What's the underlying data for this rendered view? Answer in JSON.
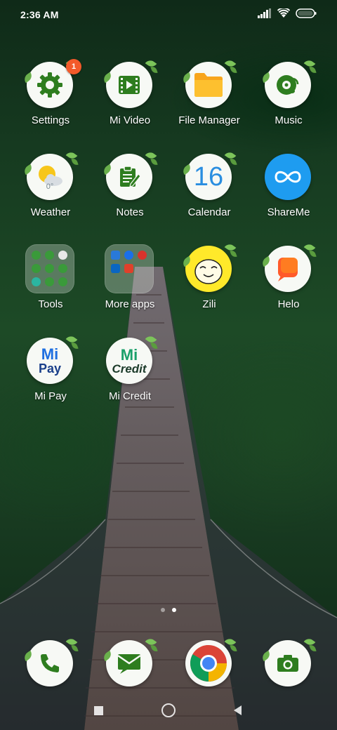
{
  "status_bar": {
    "time": "2:36 AM",
    "icons": [
      "signal-icon",
      "wifi-icon",
      "battery-icon"
    ]
  },
  "apps": [
    {
      "label": "Settings",
      "icon": "gear-icon",
      "badge": "1"
    },
    {
      "label": "Mi Video",
      "icon": "film-icon"
    },
    {
      "label": "File Manager",
      "icon": "folder-icon"
    },
    {
      "label": "Music",
      "icon": "music-disc-icon"
    },
    {
      "label": "Weather",
      "icon": "sun-cloud-icon",
      "temp": "0°"
    },
    {
      "label": "Notes",
      "icon": "note-icon"
    },
    {
      "label": "Calendar",
      "icon": "calendar-icon",
      "day": "16"
    },
    {
      "label": "ShareMe",
      "icon": "infinity-icon"
    },
    {
      "label": "Tools",
      "icon": "folder-grid-icon"
    },
    {
      "label": "More apps",
      "icon": "folder-grid-icon"
    },
    {
      "label": "Zili",
      "icon": "face-icon"
    },
    {
      "label": "Helo",
      "icon": "chat-bubble-icon"
    },
    {
      "label": "Mi Pay",
      "icon": "mi-pay-icon",
      "logo_top": "Mi",
      "logo_bottom": "Pay"
    },
    {
      "label": "Mi Credit",
      "icon": "mi-credit-icon",
      "logo_top": "Mi",
      "logo_bottom": "Credit"
    }
  ],
  "dock": [
    {
      "name": "phone",
      "icon": "phone-icon"
    },
    {
      "name": "messaging",
      "icon": "message-icon"
    },
    {
      "name": "chrome",
      "icon": "chrome-icon"
    },
    {
      "name": "camera",
      "icon": "camera-icon"
    }
  ],
  "page_indicator": {
    "pages": 2,
    "current": 2
  },
  "nav": [
    "recents-icon",
    "home-icon",
    "back-icon"
  ],
  "colors": {
    "badge": "#f35a2a",
    "leaf": "#6ab04c",
    "icon_green": "#2e7d1f"
  }
}
